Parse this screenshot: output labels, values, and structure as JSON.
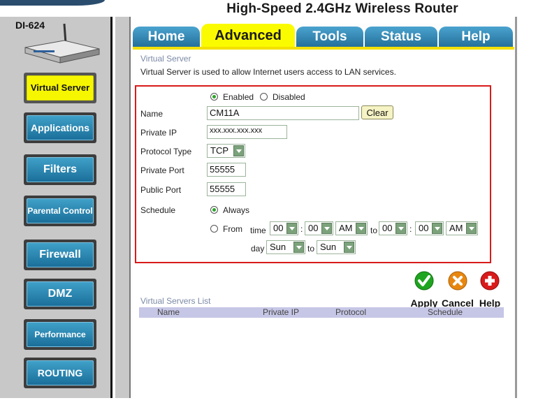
{
  "header": {
    "title": "High-Speed 2.4GHz Wireless Router",
    "model": "DI-624"
  },
  "sidebar": {
    "items": [
      {
        "label": "Virtual Server",
        "active": true
      },
      {
        "label": "Applications"
      },
      {
        "label": "Filters"
      },
      {
        "label": "Parental Control"
      },
      {
        "label": "Firewall"
      },
      {
        "label": "DMZ"
      },
      {
        "label": "Performance"
      },
      {
        "label": "ROUTING"
      }
    ]
  },
  "tabs": [
    {
      "label": "Home"
    },
    {
      "label": "Advanced",
      "active": true
    },
    {
      "label": "Tools"
    },
    {
      "label": "Status"
    },
    {
      "label": "Help"
    }
  ],
  "page": {
    "title": "Virtual Server",
    "description": "Virtual Server is used to allow Internet users access to LAN services."
  },
  "form": {
    "enabled_label": "Enabled",
    "disabled_label": "Disabled",
    "enabled_selected": true,
    "name_label": "Name",
    "name_value": "CM11A",
    "clear_label": "Clear",
    "private_ip_label": "Private IP",
    "private_ip_value": "xxx.xxx.xxx.xxx",
    "protocol_type_label": "Protocol Type",
    "protocol_value": "TCP",
    "private_port_label": "Private Port",
    "private_port_value": "55555",
    "public_port_label": "Public Port",
    "public_port_value": "55555",
    "schedule_label": "Schedule",
    "always_label": "Always",
    "from_label": "From",
    "always_selected": true,
    "time_label": "time",
    "from_hour": "00",
    "from_minute": "00",
    "from_ampm": "AM",
    "to_label": "to",
    "to_hour": "00",
    "to_minute": "00",
    "to_ampm": "AM",
    "colon": ":",
    "day_label": "day",
    "from_day": "Sun",
    "day_to_label": "to",
    "to_day": "Sun"
  },
  "actions": {
    "apply": "Apply",
    "cancel": "Cancel",
    "help": "Help"
  },
  "list": {
    "title": "Virtual Servers List",
    "columns": [
      "Name",
      "Private IP",
      "Protocol",
      "Schedule"
    ]
  },
  "colors": {
    "accent_yellow": "#fbfb00",
    "tab_blue": "#2a7fb0",
    "form_border_red": "#d81b1b",
    "apply_green": "#1fa41f",
    "cancel_orange": "#e8870f",
    "help_red": "#d81b1b"
  }
}
